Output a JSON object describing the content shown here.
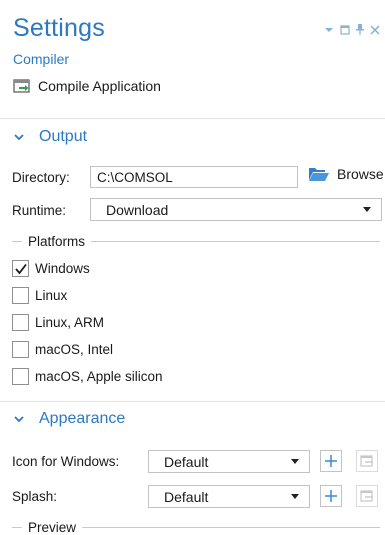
{
  "header": {
    "title": "Settings",
    "subtitle": "Compiler",
    "window_controls": [
      "chevron-down-icon",
      "restore-icon",
      "pin-icon",
      "close-icon"
    ]
  },
  "toolbar": {
    "compile_label": "Compile Application"
  },
  "output": {
    "section_title": "Output",
    "directory_label": "Directory:",
    "directory_value": "C:\\COMSOL",
    "browse_label": "Browse",
    "runtime_label": "Runtime:",
    "runtime_value": "Download"
  },
  "platforms": {
    "group_label": "Platforms",
    "items": [
      {
        "label": "Windows",
        "checked": true
      },
      {
        "label": "Linux",
        "checked": false
      },
      {
        "label": "Linux, ARM",
        "checked": false
      },
      {
        "label": "macOS, Intel",
        "checked": false
      },
      {
        "label": "macOS, Apple silicon",
        "checked": false
      }
    ]
  },
  "appearance": {
    "section_title": "Appearance",
    "icon_label": "Icon for Windows:",
    "icon_value": "Default",
    "splash_label": "Splash:",
    "splash_value": "Default",
    "preview_label": "Preview"
  },
  "colors": {
    "accent": "#2b79c2",
    "folder": "#2f7fd0",
    "compile_icon_green": "#2e9f45"
  }
}
